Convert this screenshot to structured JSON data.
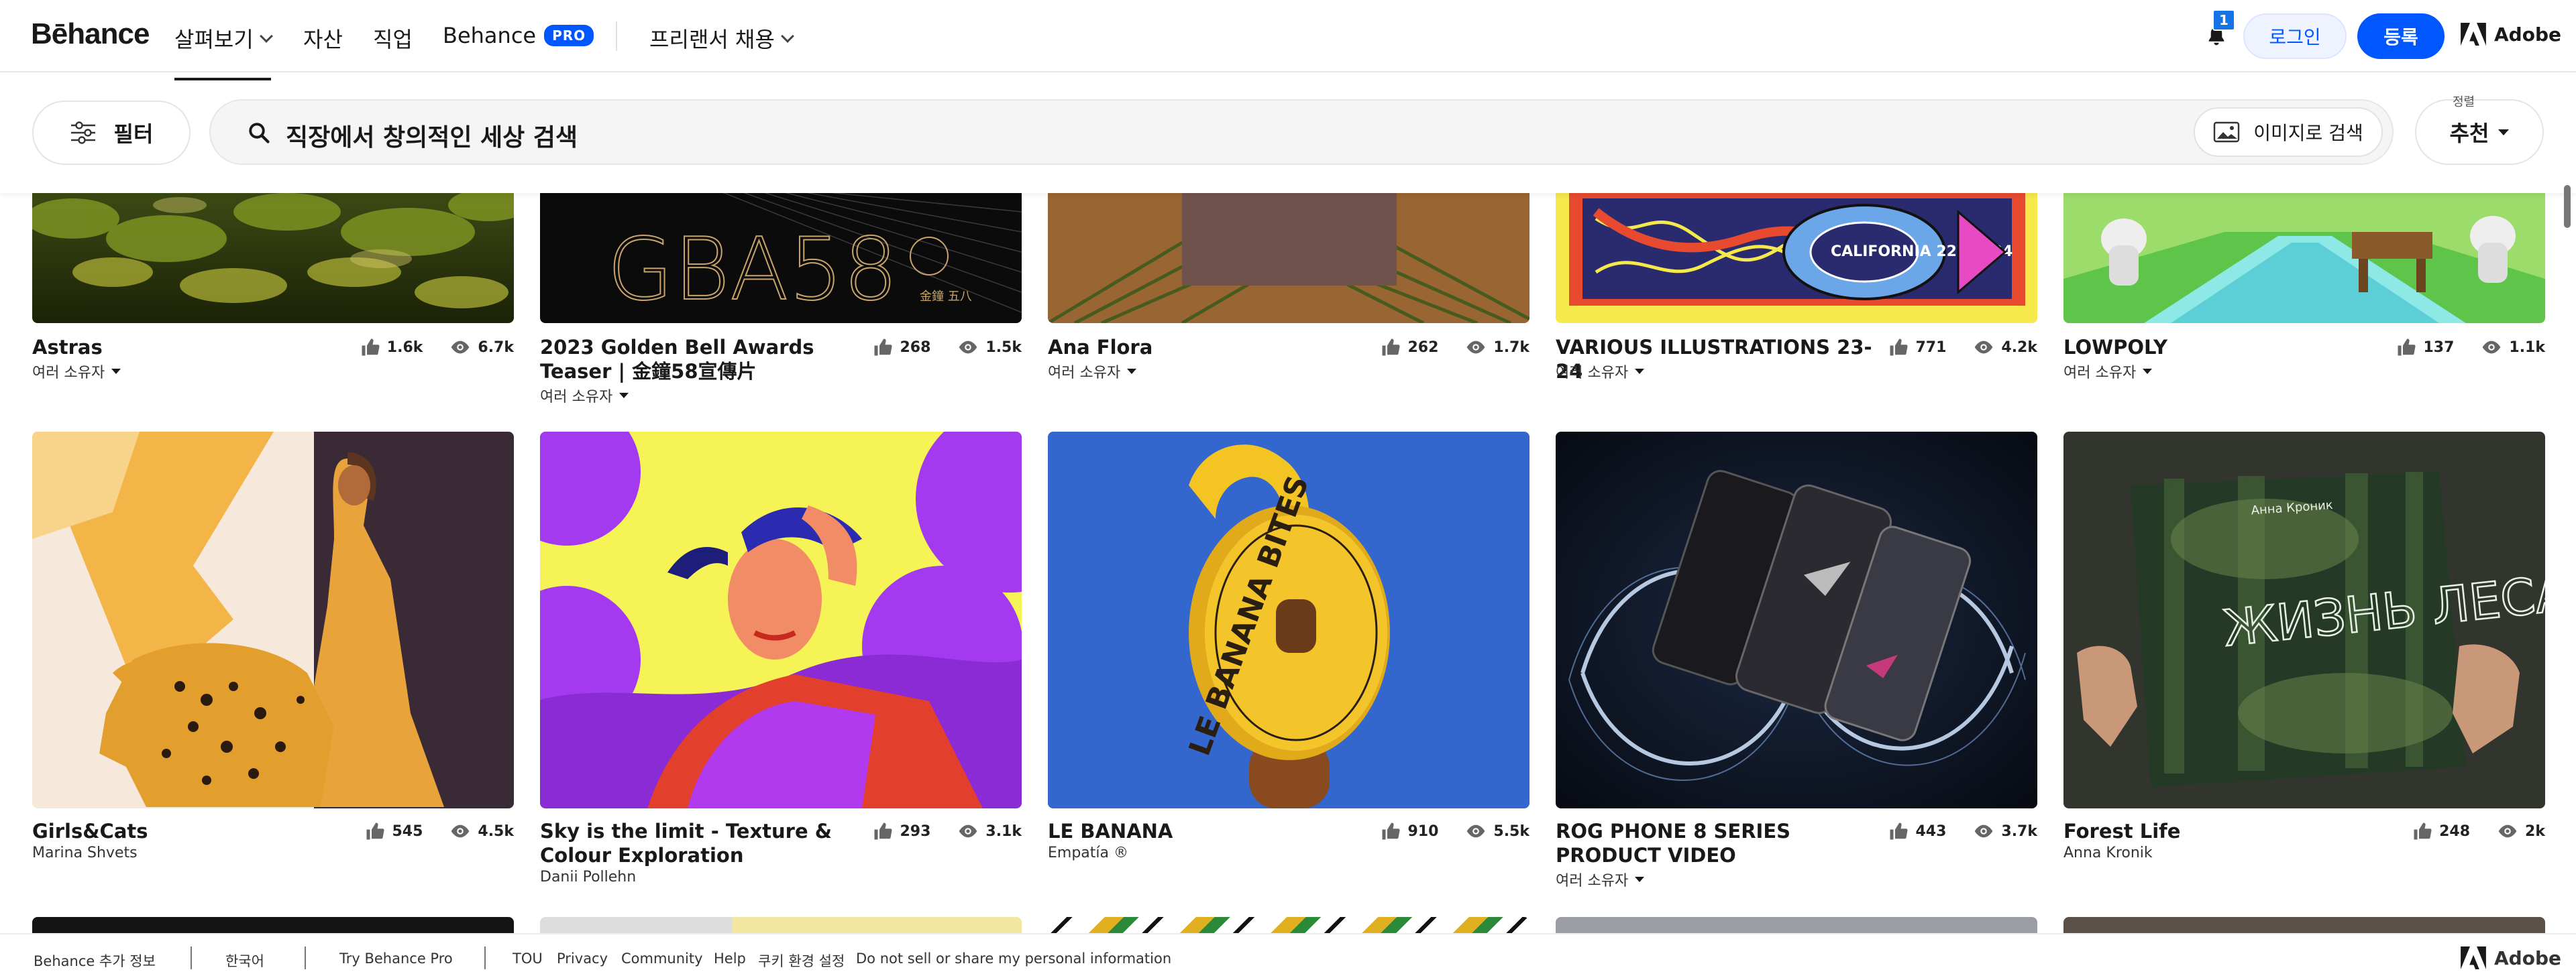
{
  "nav": {
    "logo": "Bēhance",
    "explore": "살펴보기",
    "assets": "자산",
    "jobs": "직업",
    "behance_pro": "Behance",
    "pro_badge": "PRO",
    "freelance": "프리랜서 채용",
    "notification_count": "1",
    "login": "로그인",
    "signup": "등록",
    "adobe": "Adobe"
  },
  "search": {
    "filter_label": "필터",
    "placeholder": "직장에서 창의적인 세상 검색",
    "image_search": "이미지로 검색",
    "sort_caption": "정렬",
    "sort_value": "추천"
  },
  "projects_row1": [
    {
      "title": "Astras",
      "likes": "1.6k",
      "views": "6.7k",
      "owner": "여러 소유자"
    },
    {
      "title": "2023 Golden Bell Awards Teaser | 金鐘58宣傳片",
      "likes": "268",
      "views": "1.5k",
      "owner": "여러 소유자"
    },
    {
      "title": "Ana Flora",
      "likes": "262",
      "views": "1.7k",
      "owner": "여러 소유자"
    },
    {
      "title": "VARIOUS ILLUSTRATIONS 23-24",
      "likes": "771",
      "views": "4.2k",
      "owner": "여러 소유자"
    },
    {
      "title": "LOWPOLY",
      "likes": "137",
      "views": "1.1k",
      "owner": "여러 소유자"
    }
  ],
  "projects_row2": [
    {
      "title": "Girls&Cats",
      "likes": "545",
      "views": "4.5k",
      "owner": "Marina Shvets"
    },
    {
      "title": "Sky is the limit - Texture & Colour Exploration",
      "likes": "293",
      "views": "3.1k",
      "owner": "Danii Pollehn"
    },
    {
      "title": "LE BANANA",
      "likes": "910",
      "views": "5.5k",
      "owner": "Empatía ®"
    },
    {
      "title": "ROG PHONE 8 SERIES PRODUCT VIDEO",
      "likes": "443",
      "views": "3.7k",
      "owner": "여러 소유자"
    },
    {
      "title": "Forest Life",
      "likes": "248",
      "views": "2k",
      "owner": "Anna Kronik"
    }
  ],
  "artwork_text": {
    "gba": "GBA58",
    "gba_seal": "金鐘 五八",
    "banana": "LE BANANA BITES",
    "book_title": "ЖИЗНЬ ЛЕСА",
    "book_author": "Анна Кроник",
    "sticker": "CALIFORNIA 22MAY24"
  },
  "footer": {
    "more_info": "Behance 추가 정보",
    "language": "한국어",
    "try_pro": "Try Behance Pro",
    "tou": "TOU",
    "privacy": "Privacy",
    "community": "Community",
    "help": "Help",
    "cookie": "쿠키 환경 설정",
    "do_not_sell": "Do not sell or share my personal information",
    "adobe": "Adobe"
  },
  "colors": {
    "brand_blue": "#0057ff",
    "notification_blue": "#1473e6",
    "text": "#191919"
  }
}
